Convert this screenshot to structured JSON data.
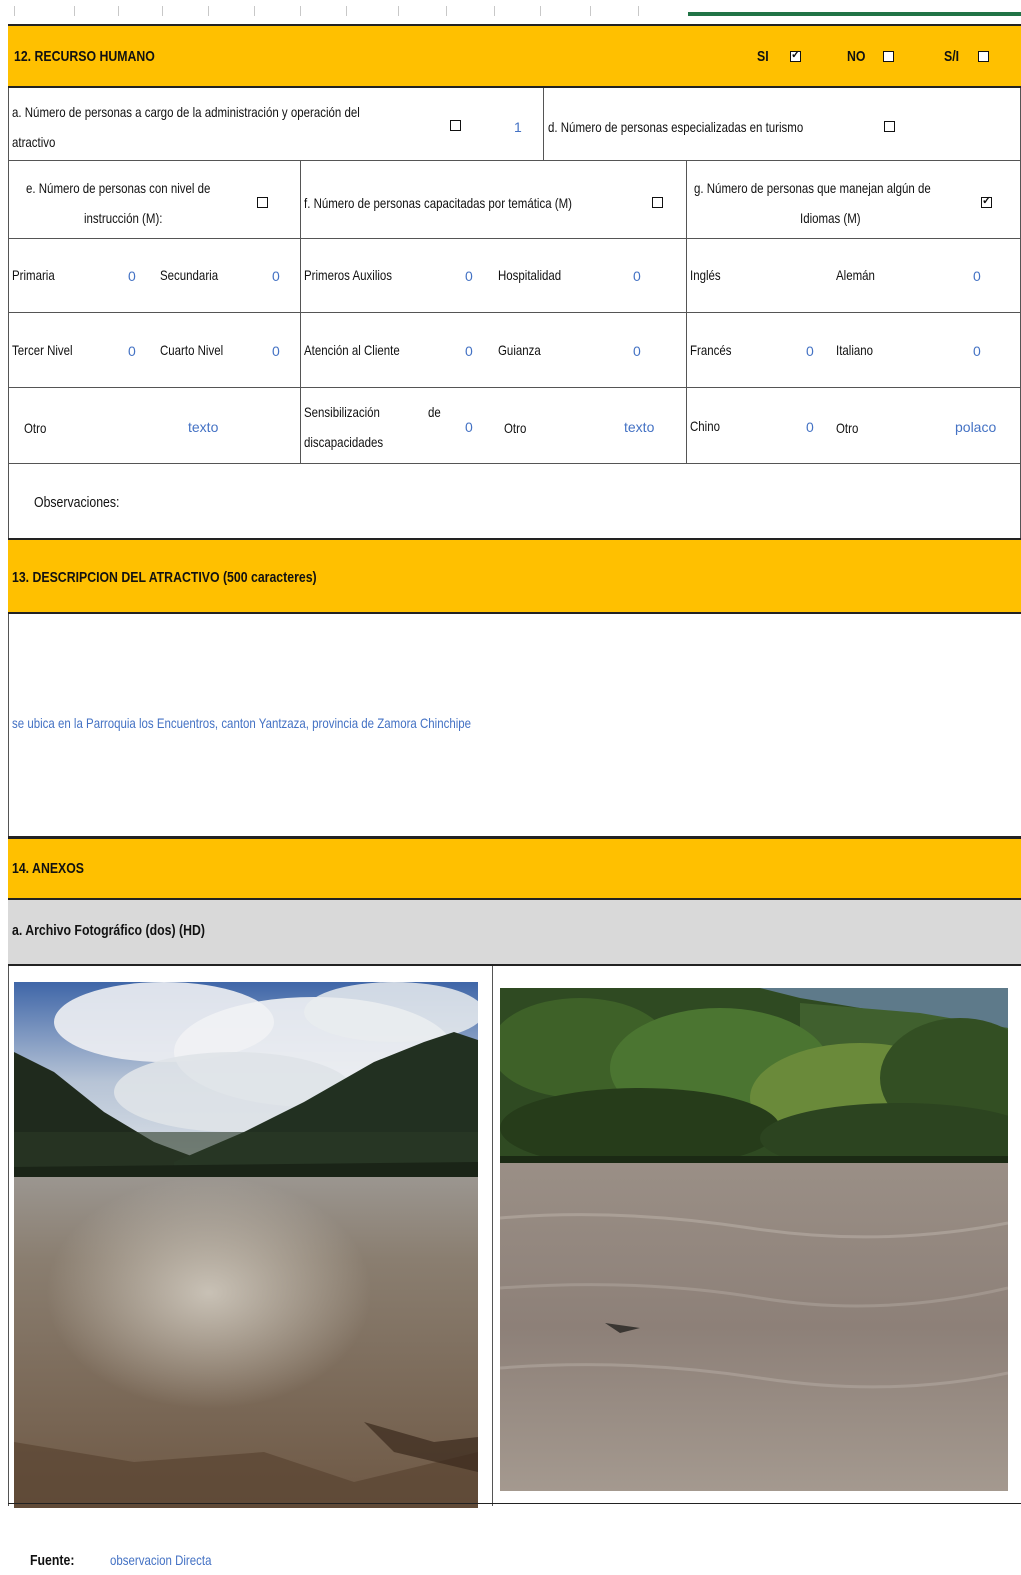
{
  "s12": {
    "title": "12. RECURSO HUMANO",
    "si_label": "SI",
    "no_label": "NO",
    "si_no_label": "S/I",
    "si_checked": true,
    "no_checked": false,
    "sin_checked": false,
    "row_a": {
      "label_line1": "a. Número de personas a cargo de la administración y operación del",
      "label_line2": "atractivo",
      "value": "1",
      "d_label": "d. Número de personas especializadas en turismo"
    },
    "col_e": {
      "line1": "e. Número de personas con nivel de",
      "line2": "instrucción (M):"
    },
    "col_f": {
      "line1": "f. Número de personas capacitadas por temática (M)"
    },
    "col_g": {
      "line1": "g. Número de personas que manejan algún de",
      "line2": "Idiomas (M)"
    },
    "rows": [
      {
        "e1": "Primaria",
        "e1v": "0",
        "e2": "Secundaria",
        "e2v": "0",
        "f1": "Primeros Auxilios",
        "f1v": "0",
        "f2": "Hospitalidad",
        "f2v": "0",
        "g1": "Inglés",
        "g1v": "",
        "g2": "Alemán",
        "g2v": "0"
      },
      {
        "e1": "Tercer Nivel",
        "e1v": "0",
        "e2": "Cuarto Nivel",
        "e2v": "0",
        "f1": "Atención al Cliente",
        "f1v": "0",
        "f2": "Guianza",
        "f2v": "0",
        "g1": "Francés",
        "g1v": "0",
        "g2": "Italiano",
        "g2v": "0"
      }
    ],
    "row3": {
      "e_other": "Otro",
      "e_other_value": "texto",
      "f1_line1": "Sensibilización",
      "f1_line1b": "de",
      "f1_line2": "discapacidades",
      "f1v": "0",
      "f2": "Otro",
      "f2v": "texto",
      "g1": "Chino",
      "g1v": "0",
      "g2": "Otro",
      "g2v": "polaco"
    },
    "observations_label": "Observaciones:"
  },
  "s13": {
    "title": "13. DESCRIPCION DEL ATRACTIVO (500 caracteres)",
    "description": "se ubica en la Parroquia los Encuentros, canton Yantzaza, provincia de Zamora Chinchipe"
  },
  "s14": {
    "title": "14. ANEXOS",
    "subtitle": "a. Archivo Fotográfico (dos) (HD)",
    "source_label": "Fuente:",
    "source_value": "observacion Directa"
  },
  "colors": {
    "section_header": "#ffc000",
    "subheader": "#d9d9d9",
    "value_text": "#4472c4",
    "excel_green": "#217346"
  }
}
